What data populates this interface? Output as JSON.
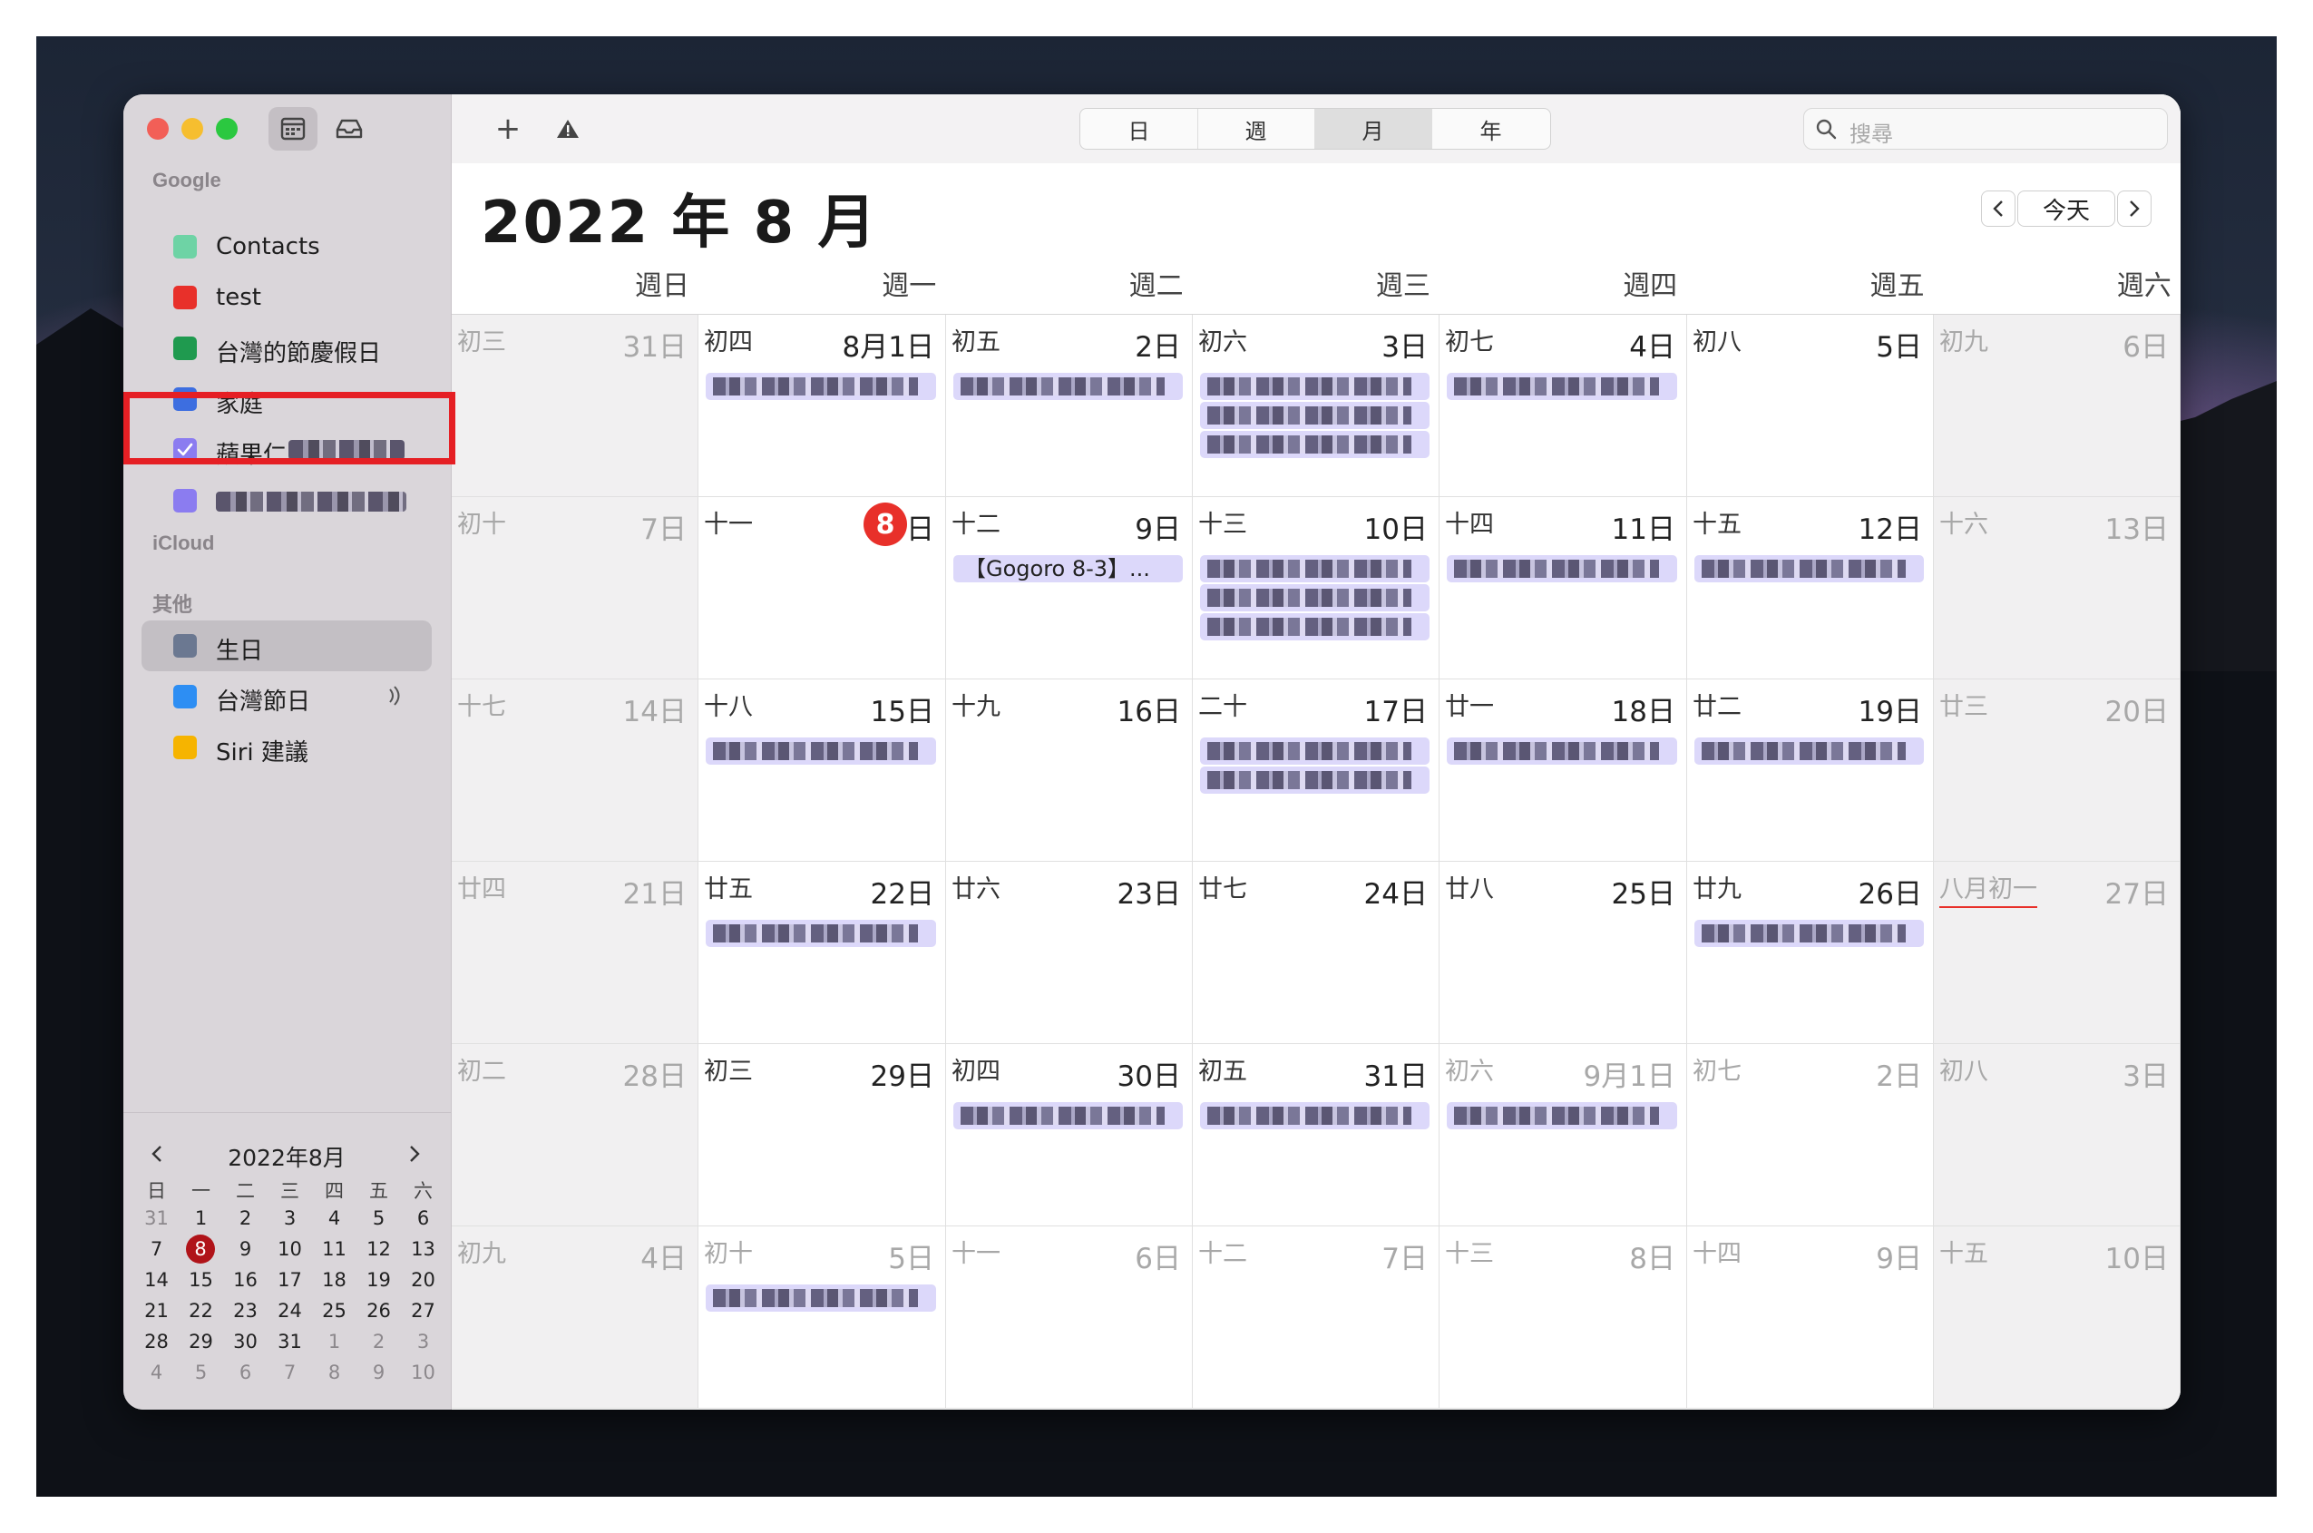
{
  "sidebar": {
    "groups": [
      {
        "heading": "Google",
        "items": [
          {
            "label": "Contacts",
            "color": "#6ed3a5",
            "checked": false
          },
          {
            "label": "test",
            "color": "#e8302a",
            "checked": false
          },
          {
            "label": "台灣的節慶假日",
            "color": "#1f9a4f",
            "checked": false
          },
          {
            "label": "家庭",
            "color": "#3d6ee0",
            "checked": false
          },
          {
            "label": "蘋果仁",
            "color": "#8b7cf0",
            "checked": true
          },
          {
            "label": "",
            "color": "#8b7cf0",
            "checked": false
          }
        ]
      },
      {
        "heading": "iCloud",
        "items": []
      },
      {
        "heading": "其他",
        "items": [
          {
            "label": "生日",
            "color": "#6b7891",
            "checked": false
          },
          {
            "label": "台灣節日",
            "color": "#2d8ef3",
            "checked": false
          },
          {
            "label": "Siri 建議",
            "color": "#f6b400",
            "checked": false
          }
        ]
      }
    ],
    "mini_calendar": {
      "title": "2022年8月",
      "weekdays": [
        "日",
        "一",
        "二",
        "三",
        "四",
        "五",
        "六"
      ],
      "weeks": [
        [
          "31",
          "1",
          "2",
          "3",
          "4",
          "5",
          "6"
        ],
        [
          "7",
          "8",
          "9",
          "10",
          "11",
          "12",
          "13"
        ],
        [
          "14",
          "15",
          "16",
          "17",
          "18",
          "19",
          "20"
        ],
        [
          "21",
          "22",
          "23",
          "24",
          "25",
          "26",
          "27"
        ],
        [
          "28",
          "29",
          "30",
          "31",
          "1",
          "2",
          "3"
        ],
        [
          "4",
          "5",
          "6",
          "7",
          "8",
          "9",
          "10"
        ]
      ],
      "today": "8"
    }
  },
  "toolbar": {
    "add_label": "+",
    "views": [
      "日",
      "週",
      "月",
      "年"
    ],
    "selected_view": "月",
    "search_placeholder": "搜尋"
  },
  "header": {
    "title": "2022 年 8 月",
    "today_label": "今天"
  },
  "weekdays": [
    "週日",
    "週一",
    "週二",
    "週三",
    "週四",
    "週五",
    "週六"
  ],
  "weeks": [
    [
      {
        "lunar": "初三",
        "day": "31日",
        "out": true,
        "events": []
      },
      {
        "lunar": "初四",
        "day": "8月1日",
        "events": [
          {
            "text": ""
          }
        ]
      },
      {
        "lunar": "初五",
        "day": "2日",
        "events": [
          {
            "text": ""
          }
        ]
      },
      {
        "lunar": "初六",
        "day": "3日",
        "events": [
          {
            "text": ""
          },
          {
            "text": ""
          },
          {
            "text": ""
          }
        ]
      },
      {
        "lunar": "初七",
        "day": "4日",
        "events": [
          {
            "text": ""
          }
        ]
      },
      {
        "lunar": "初八",
        "day": "5日",
        "events": []
      },
      {
        "lunar": "初九",
        "day": "6日",
        "events": []
      }
    ],
    [
      {
        "lunar": "初十",
        "day": "7日",
        "events": []
      },
      {
        "lunar": "十一",
        "day": "8",
        "today": true,
        "day_suffix": "日",
        "events": []
      },
      {
        "lunar": "十二",
        "day": "9日",
        "events": [
          {
            "text": "【Gogoro 8-3】..."
          }
        ]
      },
      {
        "lunar": "十三",
        "day": "10日",
        "events": [
          {
            "text": ""
          },
          {
            "text": ""
          },
          {
            "text": ""
          }
        ]
      },
      {
        "lunar": "十四",
        "day": "11日",
        "events": [
          {
            "text": ""
          }
        ]
      },
      {
        "lunar": "十五",
        "day": "12日",
        "events": [
          {
            "text": ""
          }
        ]
      },
      {
        "lunar": "十六",
        "day": "13日",
        "events": []
      }
    ],
    [
      {
        "lunar": "十七",
        "day": "14日",
        "events": []
      },
      {
        "lunar": "十八",
        "day": "15日",
        "events": [
          {
            "text": ""
          }
        ]
      },
      {
        "lunar": "十九",
        "day": "16日",
        "events": []
      },
      {
        "lunar": "二十",
        "day": "17日",
        "events": [
          {
            "text": ""
          },
          {
            "text": ""
          }
        ]
      },
      {
        "lunar": "廿一",
        "day": "18日",
        "events": [
          {
            "text": ""
          }
        ]
      },
      {
        "lunar": "廿二",
        "day": "19日",
        "events": [
          {
            "text": ""
          }
        ]
      },
      {
        "lunar": "廿三",
        "day": "20日",
        "events": []
      }
    ],
    [
      {
        "lunar": "廿四",
        "day": "21日",
        "events": []
      },
      {
        "lunar": "廿五",
        "day": "22日",
        "events": [
          {
            "text": ""
          }
        ]
      },
      {
        "lunar": "廿六",
        "day": "23日",
        "events": []
      },
      {
        "lunar": "廿七",
        "day": "24日",
        "events": []
      },
      {
        "lunar": "廿八",
        "day": "25日",
        "events": []
      },
      {
        "lunar": "廿九",
        "day": "26日",
        "events": [
          {
            "text": ""
          }
        ]
      },
      {
        "lunar": "八月初一",
        "day": "27日",
        "lunar_underline": true,
        "events": []
      }
    ],
    [
      {
        "lunar": "初二",
        "day": "28日",
        "events": []
      },
      {
        "lunar": "初三",
        "day": "29日",
        "events": []
      },
      {
        "lunar": "初四",
        "day": "30日",
        "events": [
          {
            "text": ""
          }
        ]
      },
      {
        "lunar": "初五",
        "day": "31日",
        "events": [
          {
            "text": ""
          }
        ]
      },
      {
        "lunar": "初六",
        "day": "9月1日",
        "out": true,
        "events": [
          {
            "text": ""
          }
        ]
      },
      {
        "lunar": "初七",
        "day": "2日",
        "out": true,
        "events": []
      },
      {
        "lunar": "初八",
        "day": "3日",
        "out": true,
        "events": []
      }
    ],
    [
      {
        "lunar": "初九",
        "day": "4日",
        "out": true,
        "events": []
      },
      {
        "lunar": "初十",
        "day": "5日",
        "out": true,
        "events": [
          {
            "text": ""
          }
        ]
      },
      {
        "lunar": "十一",
        "day": "6日",
        "out": true,
        "events": []
      },
      {
        "lunar": "十二",
        "day": "7日",
        "out": true,
        "events": []
      },
      {
        "lunar": "十三",
        "day": "8日",
        "out": true,
        "events": []
      },
      {
        "lunar": "十四",
        "day": "9日",
        "out": true,
        "events": []
      },
      {
        "lunar": "十五",
        "day": "10日",
        "out": true,
        "events": []
      }
    ]
  ],
  "colors": {
    "accent_event": "#dcd8fa",
    "today": "#e8302a",
    "highlight_box": "#e51f24"
  }
}
